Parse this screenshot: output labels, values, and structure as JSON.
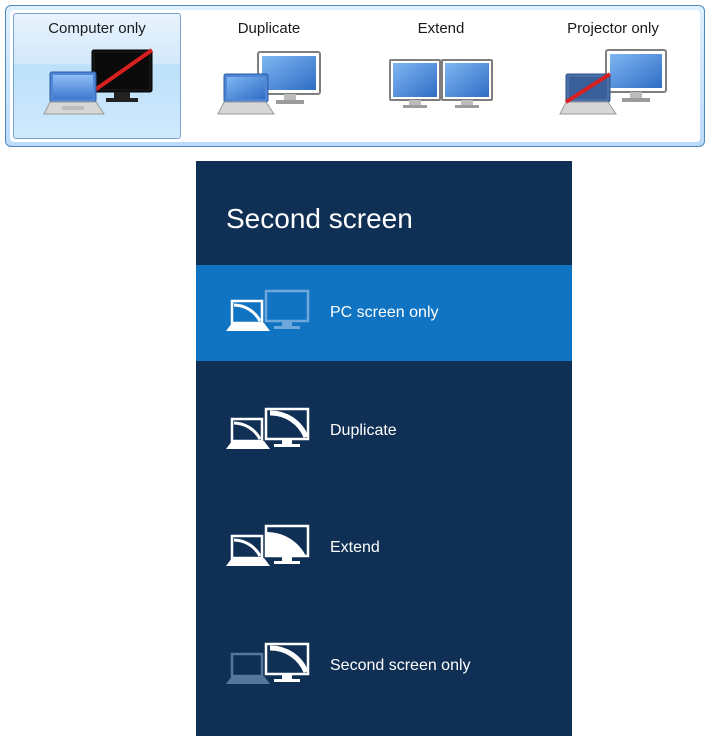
{
  "win7": {
    "options": [
      {
        "label": "Computer only",
        "selected": true
      },
      {
        "label": "Duplicate",
        "selected": false
      },
      {
        "label": "Extend",
        "selected": false
      },
      {
        "label": "Projector only",
        "selected": false
      }
    ]
  },
  "win8": {
    "title": "Second screen",
    "items": [
      {
        "label": "PC screen only",
        "selected": true
      },
      {
        "label": "Duplicate",
        "selected": false
      },
      {
        "label": "Extend",
        "selected": false
      },
      {
        "label": "Second screen only",
        "selected": false
      }
    ]
  }
}
